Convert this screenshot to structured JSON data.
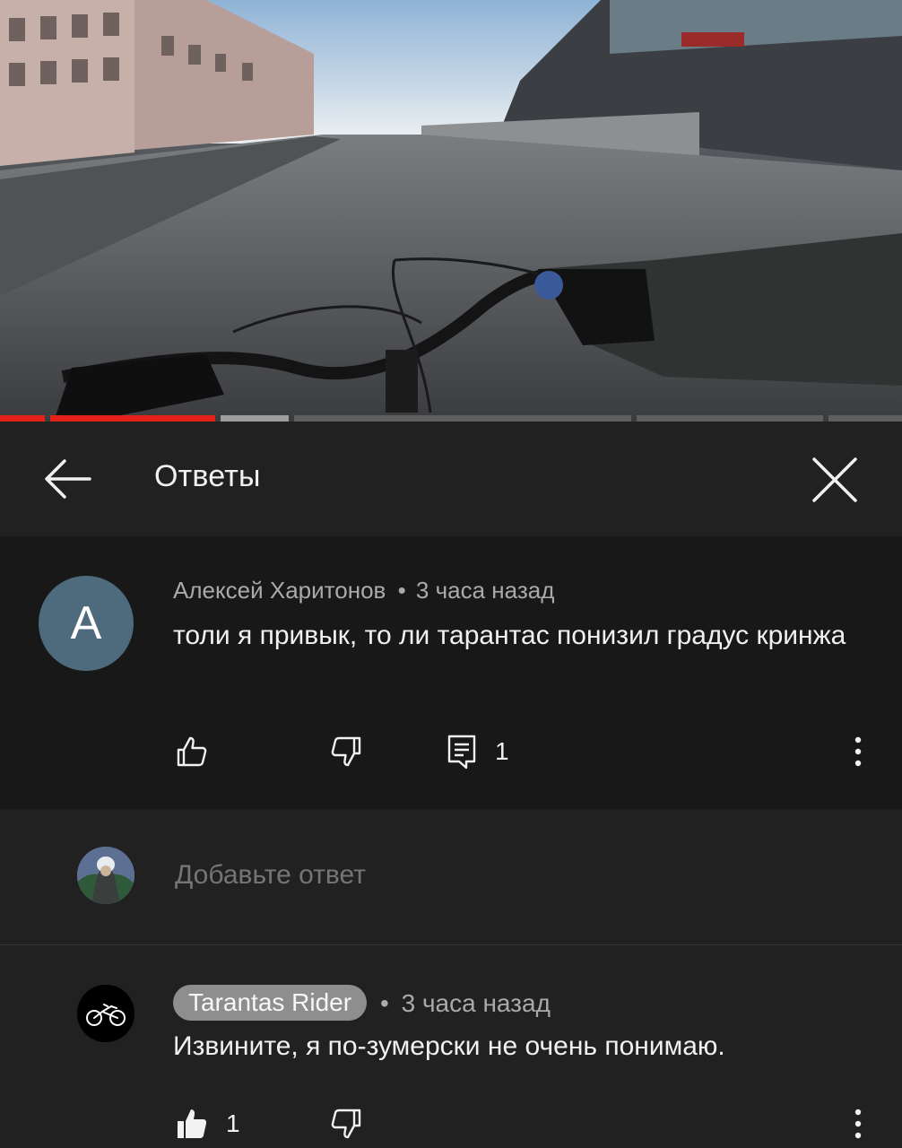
{
  "video": {
    "progress_segments": [
      {
        "state": "watched"
      },
      {
        "state": "watched"
      },
      {
        "state": "buffered"
      },
      {
        "state": "remaining"
      },
      {
        "state": "remaining"
      },
      {
        "state": "remaining"
      }
    ],
    "colors": {
      "watched": "#e62117",
      "buffered": "#9e9e9e",
      "remaining": "#5f5f5f"
    }
  },
  "header": {
    "title": "Ответы",
    "back_icon": "arrow-left-icon",
    "close_icon": "close-icon"
  },
  "parent_comment": {
    "avatar_letter": "А",
    "avatar_color": "#4e6b7e",
    "author": "Алексей Харитонов",
    "separator": "•",
    "time": "3 часа назад",
    "text": "толи я привык, то ли тарантас понизил градус кринжа",
    "reply_count": "1",
    "icons": [
      "thumb-up-outline-icon",
      "thumb-down-outline-icon",
      "comment-icon",
      "more-vert-icon"
    ]
  },
  "add_reply": {
    "placeholder": "Добавьте ответ"
  },
  "reply_comment": {
    "author": "Tarantas Rider",
    "separator": "•",
    "time": "3 часа назад",
    "text": "Извините, я по-зумерски не очень понимаю.",
    "like_count": "1",
    "author_chip_color": "#8e8e8e",
    "icons": [
      "thumb-up-filled-icon",
      "thumb-down-outline-icon",
      "more-vert-icon",
      "bicycle-icon"
    ]
  }
}
